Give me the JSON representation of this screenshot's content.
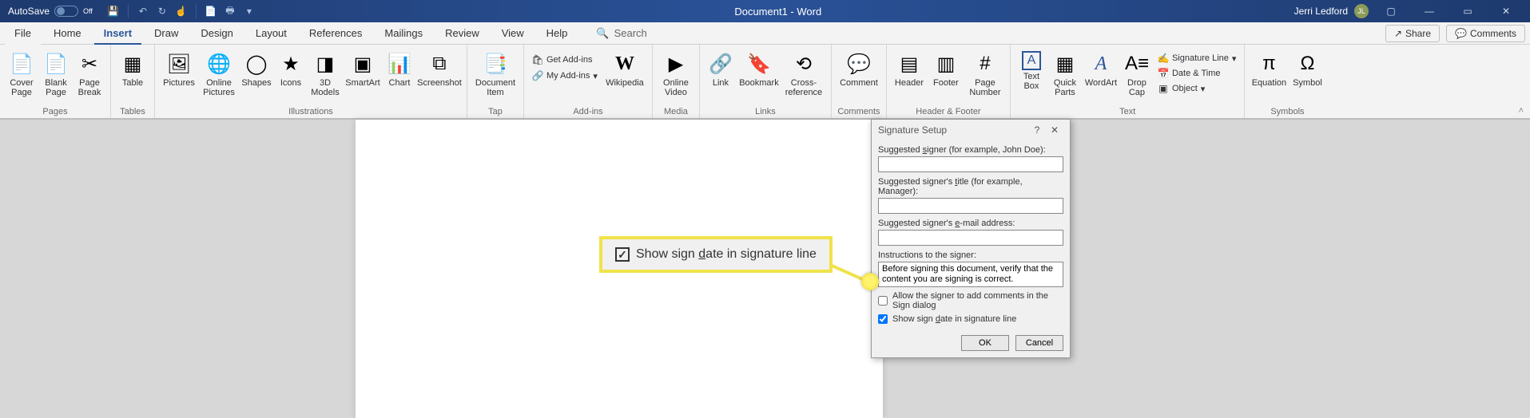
{
  "title": {
    "autosave_label": "AutoSave",
    "autosave_state": "Off",
    "document_title": "Document1 - Word",
    "user_name": "Jerri Ledford",
    "user_initials": "JL"
  },
  "tabs": {
    "file": "File",
    "home": "Home",
    "insert": "Insert",
    "draw": "Draw",
    "design": "Design",
    "layout": "Layout",
    "references": "References",
    "mailings": "Mailings",
    "review": "Review",
    "view": "View",
    "help": "Help",
    "search": "Search",
    "share": "Share",
    "comments": "Comments"
  },
  "ribbon": {
    "pages": {
      "cover_page": "Cover Page",
      "blank_page": "Blank Page",
      "page_break": "Page Break",
      "label": "Pages"
    },
    "tables": {
      "table": "Table",
      "label": "Tables"
    },
    "illustrations": {
      "pictures": "Pictures",
      "online_pictures": "Online Pictures",
      "shapes": "Shapes",
      "icons": "Icons",
      "models": "3D Models",
      "smartart": "SmartArt",
      "chart": "Chart",
      "screenshot": "Screenshot",
      "label": "Illustrations"
    },
    "tap": {
      "document_item": "Document Item",
      "label": "Tap"
    },
    "addins": {
      "get_addins": "Get Add-ins",
      "my_addins": "My Add-ins",
      "wikipedia": "Wikipedia",
      "label": "Add-ins"
    },
    "media": {
      "online_video": "Online Video",
      "label": "Media"
    },
    "links": {
      "link": "Link",
      "bookmark": "Bookmark",
      "crossref": "Cross-reference",
      "label": "Links"
    },
    "comments": {
      "comment": "Comment",
      "label": "Comments"
    },
    "header_footer": {
      "header": "Header",
      "footer": "Footer",
      "page_number": "Page Number",
      "label": "Header & Footer"
    },
    "text": {
      "text_box": "Text Box",
      "quick_parts": "Quick Parts",
      "wordart": "WordArt",
      "drop_cap": "Drop Cap",
      "signature_line": "Signature Line",
      "date_time": "Date & Time",
      "object": "Object",
      "label": "Text"
    },
    "symbols": {
      "equation": "Equation",
      "symbol": "Symbol",
      "label": "Symbols"
    }
  },
  "dialog": {
    "title": "Signature Setup",
    "suggested_signer": "Suggested signer (for example, John Doe):",
    "suggested_title": "Suggested signer's title (for example, Manager):",
    "suggested_email": "Suggested signer's e-mail address:",
    "instructions_label": "Instructions to the signer:",
    "instructions_value": "Before signing this document, verify that the content you are signing is correct.",
    "allow_comments": "Allow the signer to add comments in the Sign dialog",
    "show_date": "Show sign date in signature line",
    "ok": "OK",
    "cancel": "Cancel"
  },
  "callout": {
    "text": "Show sign date in signature line"
  }
}
